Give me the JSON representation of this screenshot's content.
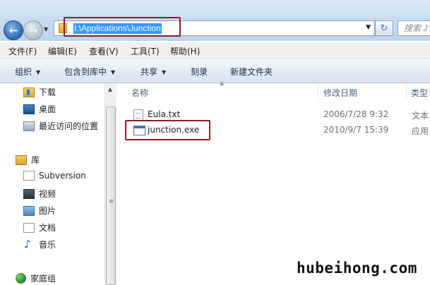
{
  "address_bar": {
    "path": "I:\\Applications\\Junction",
    "search_placeholder": "搜索 J"
  },
  "menu": [
    "文件(F)",
    "编辑(E)",
    "查看(V)",
    "工具(T)",
    "帮助(H)"
  ],
  "toolbar": {
    "organize": "组织",
    "include_in_library": "包含到库中",
    "share": "共享",
    "burn": "刻录",
    "new_folder": "新建文件夹"
  },
  "nav": {
    "favorites": [
      {
        "label": "下载",
        "icon": "downloads-folder-icon"
      },
      {
        "label": "桌面",
        "icon": "desktop-icon"
      },
      {
        "label": "最近访问的位置",
        "icon": "recent-places-icon"
      }
    ],
    "library": {
      "label": "库",
      "icon": "library-icon"
    },
    "library_items": [
      {
        "label": "Subversion",
        "icon": "document-icon"
      },
      {
        "label": "视频",
        "icon": "video-icon"
      },
      {
        "label": "图片",
        "icon": "picture-icon"
      },
      {
        "label": "文档",
        "icon": "document-icon"
      },
      {
        "label": "音乐",
        "icon": "music-icon"
      }
    ],
    "homegroup": {
      "label": "家庭组",
      "icon": "homegroup-icon"
    }
  },
  "columns": {
    "name": "名称",
    "modified": "修改日期",
    "type": "类型"
  },
  "files": [
    {
      "name": "Eula.txt",
      "modified": "2006/7/28 9:32",
      "type": "文本",
      "icon": "text-file-icon"
    },
    {
      "name": "junction.exe",
      "modified": "2010/9/7 15:39",
      "type": "应用",
      "icon": "exe-file-icon"
    }
  ],
  "watermark": "hubeihong.com",
  "colors": {
    "highlight_box": "#8e1b2c",
    "selection": "#3399ff"
  }
}
